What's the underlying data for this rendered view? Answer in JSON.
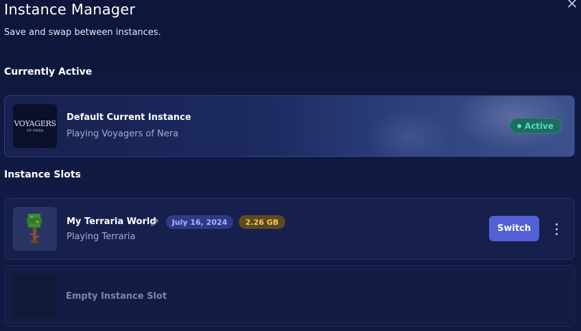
{
  "header": {
    "title": "Instance Manager",
    "subtitle": "Save and swap between instances.",
    "close_icon": "close-icon"
  },
  "current_section": {
    "label": "Currently Active",
    "instance": {
      "name": "Default Current Instance",
      "status": "Playing Voyagers of Nera",
      "logo_text": "VOYAGERS",
      "logo_subtext": "OF NERA",
      "badge": "Active",
      "badge_color": "#4be0b2"
    }
  },
  "slots_section": {
    "label": "Instance Slots",
    "slots": [
      {
        "name": "My Terraria World",
        "status": "Playing Terraria",
        "date": "July 16, 2024",
        "size": "2.26 GB",
        "action_label": "Switch",
        "icon": "terraria-tree-icon"
      }
    ],
    "empty_slot_label": "Empty Instance Slot"
  },
  "colors": {
    "background": "#0e1639",
    "accent": "#5461d6",
    "date_pill": "#2f3a86",
    "size_pill": "#ffc94a"
  }
}
